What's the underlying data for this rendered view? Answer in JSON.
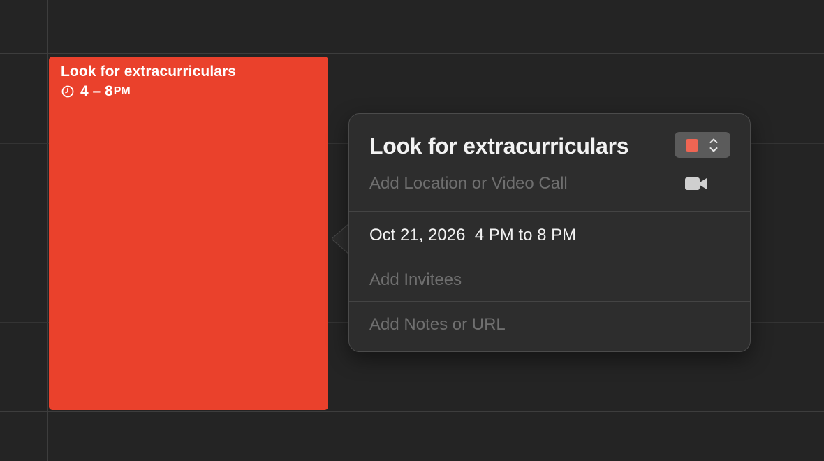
{
  "event": {
    "title": "Look for extracurriculars",
    "time_range": "4 – 8",
    "time_suffix": "PM",
    "color": "#ea412c"
  },
  "popover": {
    "title": "Look for extracurriculars",
    "calendar_color": "#ef6553",
    "location_placeholder": "Add Location or Video Call",
    "video_icon": "video-camera-icon",
    "date": "Oct 21, 2026",
    "time_range": "4 PM to 8 PM",
    "invitees_placeholder": "Add Invitees",
    "notes_placeholder": "Add Notes or URL"
  },
  "theme": {
    "background": "#242424",
    "grid_line": "#3d3d3d",
    "popover_bg": "#2d2d2d"
  }
}
